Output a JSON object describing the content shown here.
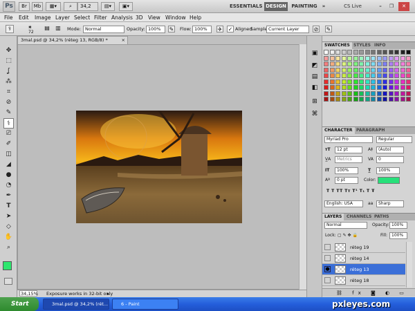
{
  "app": {
    "logo": "Ps",
    "zoom": "34,2",
    "workspaces": [
      "ESSENTIALS",
      "DESIGN",
      "PAINTING"
    ],
    "more": "»",
    "cslive": "CS Live"
  },
  "menu": [
    "File",
    "Edit",
    "Image",
    "Layer",
    "Select",
    "Filter",
    "Analysis",
    "3D",
    "View",
    "Window",
    "Help"
  ],
  "options": {
    "brush_size": "72",
    "mode_label": "Mode:",
    "mode_value": "Normal",
    "opacity_label": "Opacity:",
    "opacity_value": "100%",
    "flow_label": "Flow:",
    "flow_value": "100%",
    "aligned_label": "Aligned",
    "sample_label": "Sample:",
    "sample_value": "Current Layer"
  },
  "document": {
    "tab": "3mal.psd @ 34,2% (réteg 13, RGB/8) *",
    "close": "×",
    "zoom_status": "34,15%",
    "status_text": "Exposure works in 32-bit only"
  },
  "tools": [
    "✥",
    "⬚",
    "ʆ",
    "⁂",
    "⌗",
    "⊘",
    "✎",
    "⚕",
    "⎚",
    "✐",
    "◫",
    "◢",
    "●",
    "◔",
    "✒",
    "T",
    "➤",
    "◇",
    "✋",
    "⌕"
  ],
  "panels": {
    "swatches_tabs": [
      "SWATCHES",
      "STYLES",
      "INFO"
    ],
    "character_tabs": [
      "CHARACTER",
      "PARAGRAPH"
    ],
    "character": {
      "font": "Myriad Pro",
      "style": "Regular",
      "size": "12 pt",
      "leading": "(Auto)",
      "kerning": "Metrics",
      "tracking": "0",
      "vscale": "100%",
      "hscale": "100%",
      "baseline": "0 pt",
      "color_label": "Color:",
      "language": "English: USA",
      "aa": "Sharp",
      "styles_row": "T  T  TT  Tт  T¹  T₁  T  Ŧ"
    },
    "layers_tabs": [
      "LAYERS",
      "CHANNELS",
      "PATHS"
    ],
    "layers": {
      "blend": "Normal",
      "opacity_label": "Opacity:",
      "opacity_value": "100%",
      "lock_label": "Lock:",
      "fill_label": "Fill:",
      "fill_value": "100%",
      "rows": [
        {
          "name": "réteg 19"
        },
        {
          "name": "réteg 14"
        },
        {
          "name": "réteg 13"
        },
        {
          "name": "réteg 18"
        }
      ]
    }
  },
  "colors": {
    "foreground": "#2ee66e",
    "background": "#ffffff",
    "accent_selected": "#3b6fd8",
    "text_color_swatch": "#27e07a"
  },
  "taskbar": {
    "start": "Start",
    "tasks": [
      "3mal.psd @ 34,2% (rét...",
      "6 - Paint"
    ],
    "watermark": "pxleyes.com"
  }
}
